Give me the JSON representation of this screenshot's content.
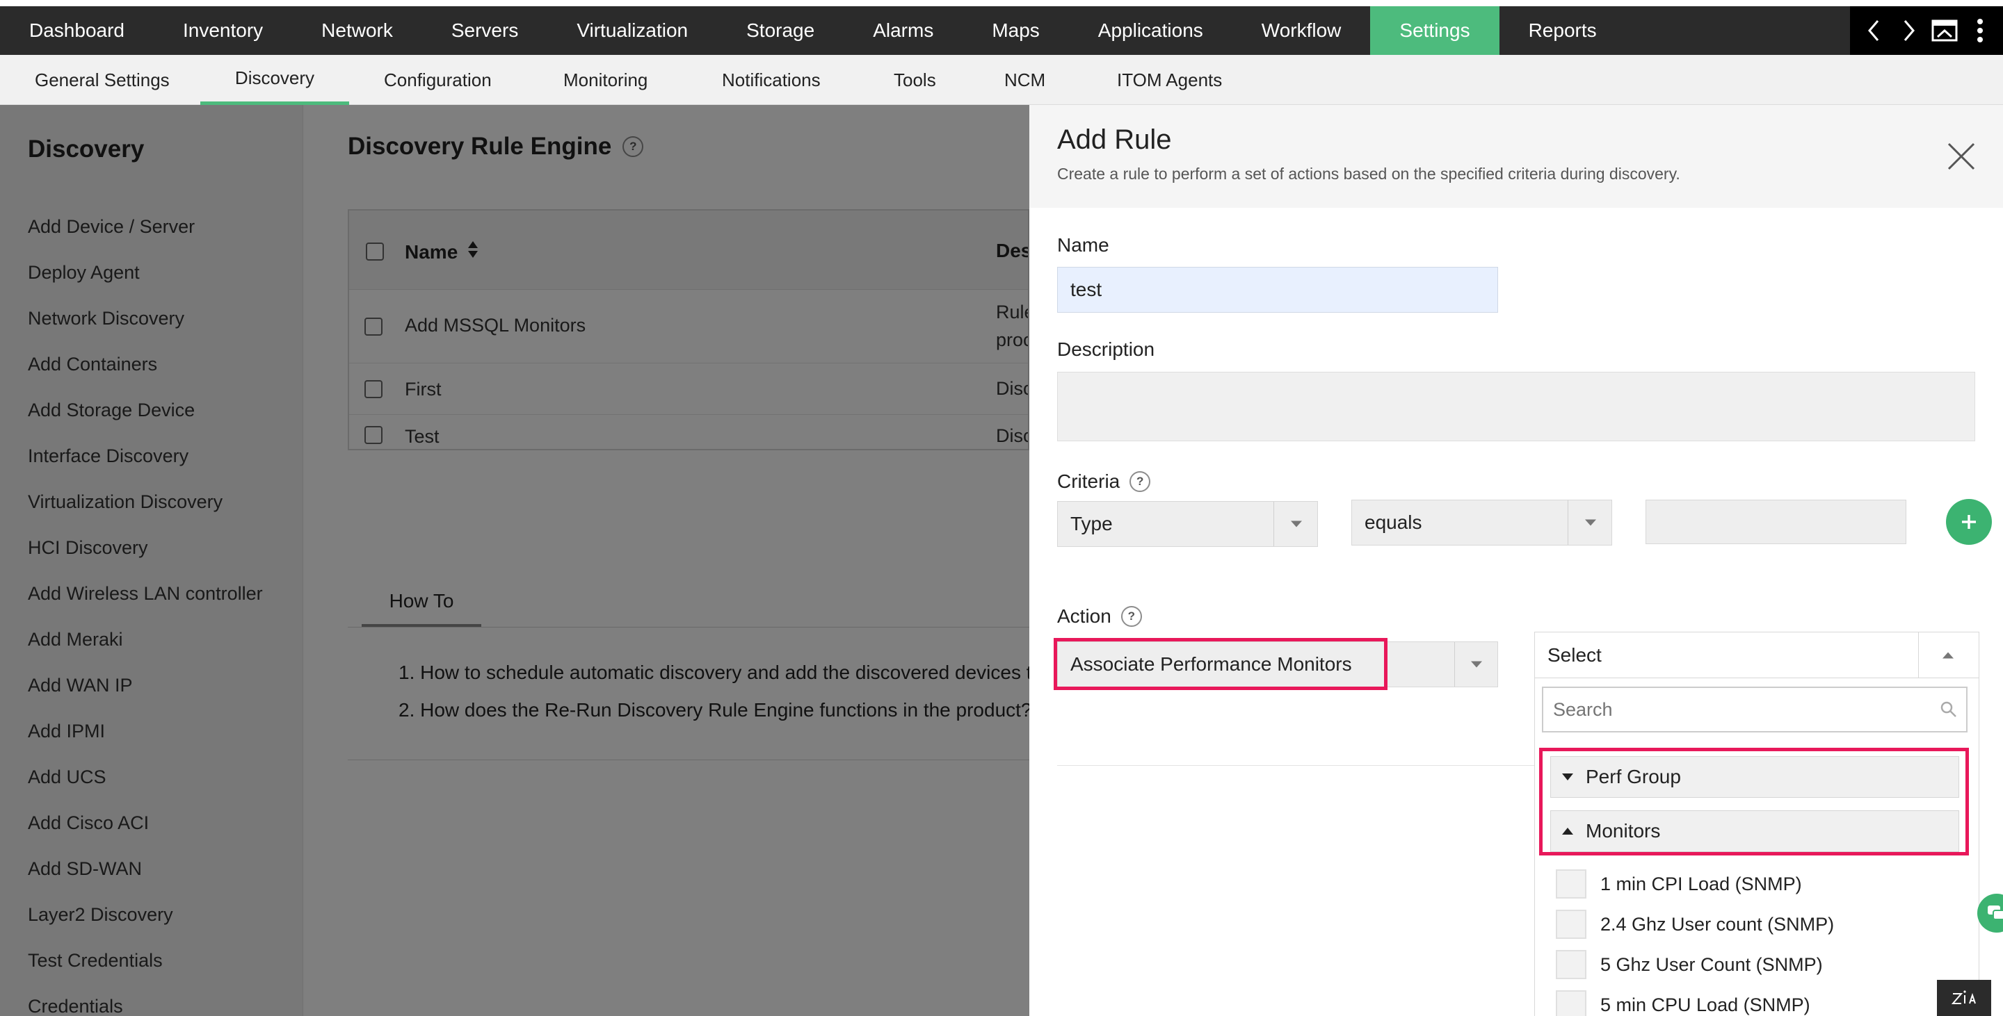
{
  "top_nav": {
    "items": [
      "Dashboard",
      "Inventory",
      "Network",
      "Servers",
      "Virtualization",
      "Storage",
      "Alarms",
      "Maps",
      "Applications",
      "Workflow",
      "Settings",
      "Reports"
    ],
    "active": "Settings",
    "icons": [
      "chevron-left-icon",
      "chevron-right-icon",
      "window-icon",
      "more-vertical-icon"
    ]
  },
  "sub_nav": {
    "items": [
      "General Settings",
      "Discovery",
      "Configuration",
      "Monitoring",
      "Notifications",
      "Tools",
      "NCM",
      "ITOM Agents"
    ],
    "active": "Discovery"
  },
  "sidebar": {
    "title": "Discovery",
    "items": [
      "Add Device / Server",
      "Deploy Agent",
      "Network Discovery",
      "Add Containers",
      "Add Storage Device",
      "Interface Discovery",
      "Virtualization Discovery",
      "HCI Discovery",
      "Add Wireless LAN controller",
      "Add Meraki",
      "Add WAN IP",
      "Add IPMI",
      "Add UCS",
      "Add Cisco ACI",
      "Add SD-WAN",
      "Layer2 Discovery",
      "Test Credentials",
      "Credentials"
    ]
  },
  "main": {
    "title": "Discovery Rule Engine",
    "help": "?",
    "table": {
      "columns": [
        "Name",
        "Des"
      ],
      "rows": [
        {
          "name": "Add MSSQL Monitors",
          "desc_line1": "Rule",
          "desc_line2": "proc"
        },
        {
          "name": "First",
          "desc_line1": "Disc"
        },
        {
          "name": "Test",
          "desc_line1": "Disc"
        }
      ]
    },
    "howto": {
      "tab": "How To",
      "items": [
        "1. How to schedule automatic discovery and add the discovered devices to t",
        "2. How does the Re-Run Discovery Rule Engine functions in the product?"
      ]
    }
  },
  "panel": {
    "title": "Add Rule",
    "subtitle": "Create a rule to perform a set of actions based on the specified criteria during discovery.",
    "name_label": "Name",
    "name_value": "test",
    "description_label": "Description",
    "description_value": "",
    "criteria_label": "Criteria",
    "criteria_help": "?",
    "criteria_type": "Type",
    "criteria_operator": "equals",
    "criteria_value": "",
    "action_label": "Action",
    "action_help": "?",
    "action_value": "Associate Performance Monitors",
    "dropdown": {
      "selected": "Select",
      "search_placeholder": "Search",
      "groups": [
        {
          "label": "Perf Group",
          "expanded": false
        },
        {
          "label": "Monitors",
          "expanded": true
        }
      ],
      "options": [
        "1 min CPI Load (SNMP)",
        "2.4 Ghz User count (SNMP)",
        "5 Ghz User Count (SNMP)",
        "5 min CPU Load (SNMP)"
      ]
    }
  },
  "footer": {
    "badge": "Zia"
  },
  "colors": {
    "accent_green": "#4dbb7d",
    "highlight_red": "#e8185a",
    "nav_dark": "#2b2b2b"
  }
}
